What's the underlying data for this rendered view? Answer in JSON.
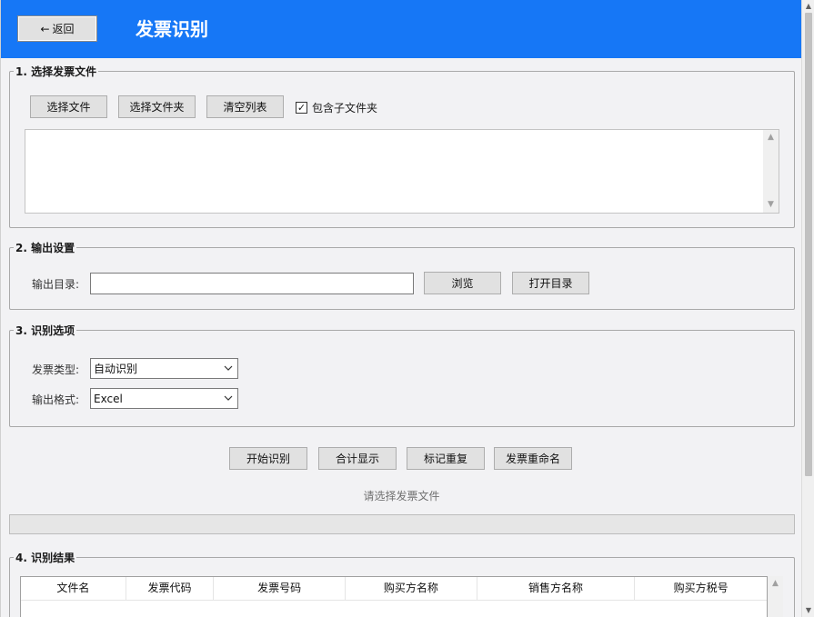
{
  "header": {
    "back_label": "返回",
    "back_arrow": "←",
    "title": "发票识别",
    "bg_color": "#1677f6"
  },
  "section_files": {
    "legend": "1. 选择发票文件",
    "select_file": "选择文件",
    "select_folder": "选择文件夹",
    "clear_list": "清空列表",
    "include_subfolders": {
      "label": "包含子文件夹",
      "checked": true,
      "mark": "✓"
    },
    "file_list": []
  },
  "section_output": {
    "legend": "2. 输出设置",
    "dir_label": "输出目录:",
    "dir_value": "",
    "browse": "浏览",
    "open_dir": "打开目录"
  },
  "section_options": {
    "legend": "3. 识别选项",
    "type_label": "发票类型:",
    "type_value": "自动识别",
    "format_label": "输出格式:",
    "format_value": "Excel"
  },
  "actions": {
    "start": "开始识别",
    "sum": "合计显示",
    "mark_dup": "标记重复",
    "rename": "发票重命名"
  },
  "status_text": "请选择发票文件",
  "progress": {
    "value": 0
  },
  "section_results": {
    "legend": "4. 识别结果",
    "columns": [
      "文件名",
      "发票代码",
      "发票号码",
      "购买方名称",
      "销售方名称",
      "购买方税号"
    ],
    "rows": []
  }
}
